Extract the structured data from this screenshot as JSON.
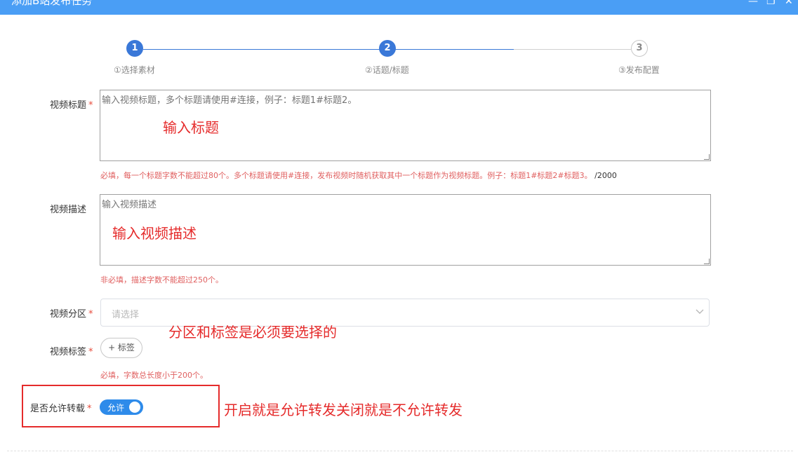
{
  "header": {
    "title": "添加B站发布任务",
    "minimize": "—",
    "restore": "❐",
    "close": "✕"
  },
  "steps": [
    {
      "number": "1",
      "label": "①选择素材",
      "state": "done"
    },
    {
      "number": "2",
      "label": "②话题/标题",
      "state": "active"
    },
    {
      "number": "3",
      "label": "③发布配置",
      "state": "pending"
    }
  ],
  "form": {
    "title": {
      "label": "视频标题",
      "required": "*",
      "placeholder": "输入视频标题，多个标题请使用#连接，例子：标题1#标题2。",
      "hint": "必填，每一个标题字数不能超过80个。多个标题请使用#连接，发布视频时随机获取其中一个标题作为视频标题。例子：标题1#标题2#标题3。",
      "counter": "/2000"
    },
    "description": {
      "label": "视频描述",
      "placeholder": "输入视频描述",
      "hint": "非必填，描述字数不能超过250个。"
    },
    "category": {
      "label": "视频分区",
      "required": "*",
      "placeholder": "请选择"
    },
    "tags": {
      "label": "视频标签",
      "required": "*",
      "button_label": "+ 标签",
      "hint": "必填，字数总长度小于200个。"
    },
    "repost": {
      "label": "是否允许转载",
      "required": "*",
      "switch_text": "允许",
      "enabled": true
    }
  },
  "annotations": {
    "title_note": "输入标题",
    "description_note": "输入视频描述",
    "category_note": "分区和标签是必须要选择的",
    "repost_note": "开启就是允许转发关闭就是不允许转发"
  },
  "colors": {
    "header": "#4a9ef5",
    "step_active": "#3a78d8",
    "annotation": "#e52b2b",
    "hint": "#e06060",
    "switch_on": "#2e8bea"
  }
}
